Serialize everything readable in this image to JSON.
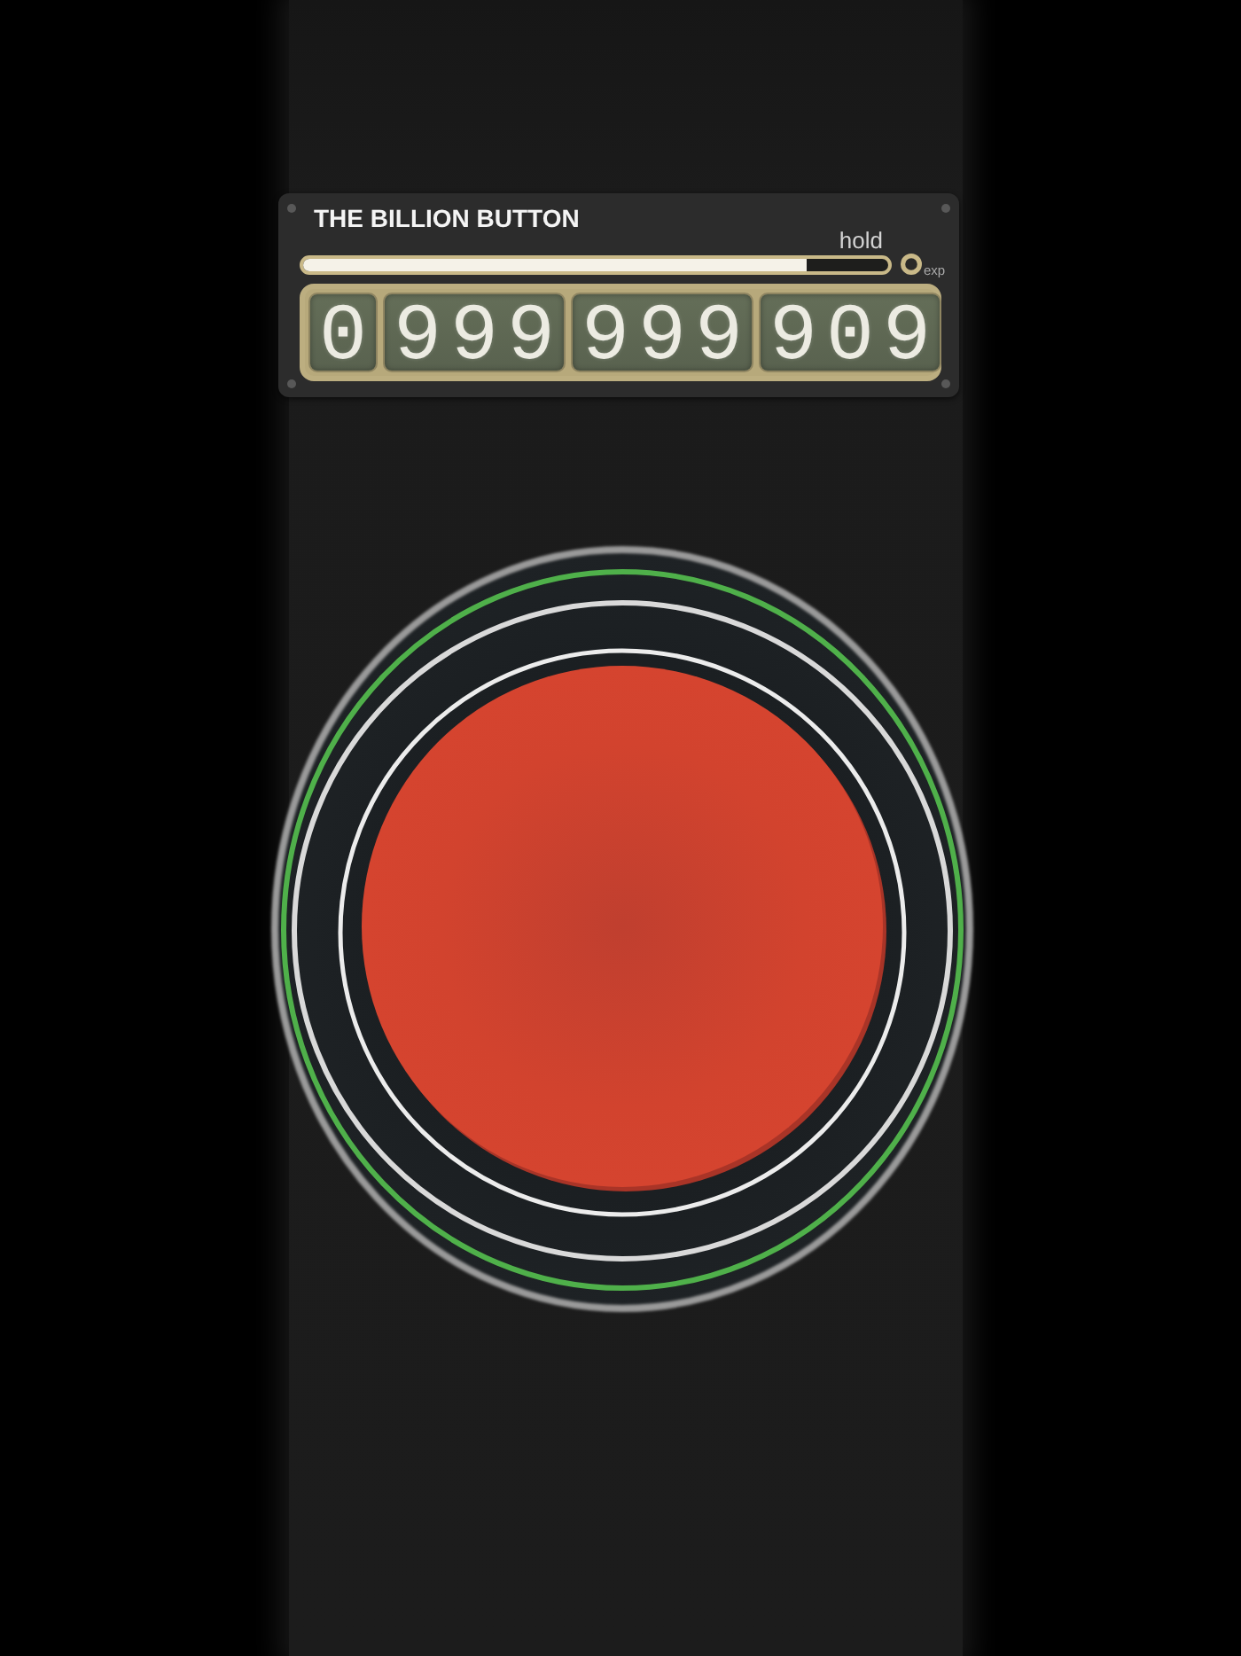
{
  "header": {
    "title": "THE BILLION BUTTON",
    "hold_label": "hold",
    "hold_progress": {
      "level": 0.86
    },
    "exp_label": "exp",
    "counter_groups": [
      "0",
      "999",
      "999",
      "909"
    ]
  }
}
